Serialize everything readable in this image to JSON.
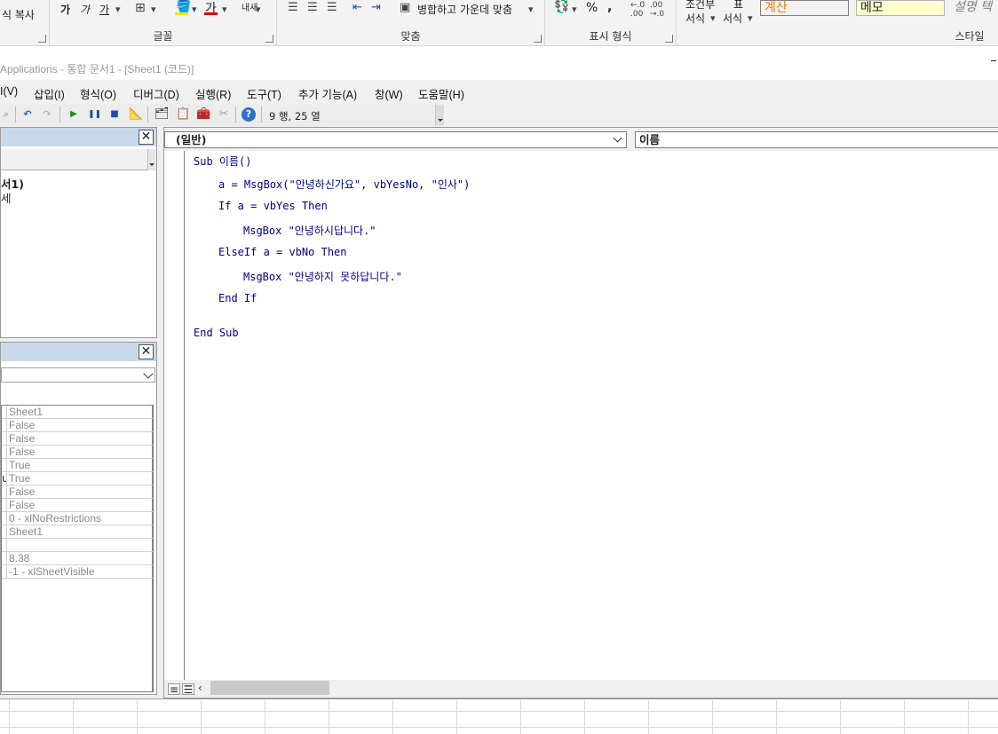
{
  "ribbon": {
    "clipboard_copy_label": "식 복사",
    "font_group_label": "글꼴",
    "align_group_label": "맞춤",
    "merge_label": "병합하고 가운데 맞춤",
    "number_group_label": "표시 형식",
    "conditional_label_1": "조건부",
    "conditional_label_2": "서식",
    "table_label_1": "표",
    "table_label_2": "서식",
    "styles_group_label": "스타일",
    "style_calc": "계산",
    "style_memo": "메모",
    "style_desc": "설명 텍",
    "font_btns": [
      "가",
      "가",
      "가"
    ],
    "wrap_label": "내새",
    "percent": "%",
    "comma": ","
  },
  "vbe": {
    "title": "Applications - 통합 문서1 - [Sheet1 (코드)]",
    "menu": [
      "I(V)",
      "삽입(I)",
      "형식(O)",
      "디버그(D)",
      "실행(R)",
      "도구(T)",
      "추가 기능(A)",
      "창(W)",
      "도움말(H)"
    ],
    "toolbar_status": "9 행, 25 열"
  },
  "project": {
    "tree_items": [
      "서1)",
      "세"
    ]
  },
  "properties": {
    "rows": [
      {
        "key": "",
        "value": "Sheet1"
      },
      {
        "key": "",
        "value": "False"
      },
      {
        "key": "",
        "value": "False"
      },
      {
        "key": "",
        "value": "False"
      },
      {
        "key": "",
        "value": "True"
      },
      {
        "key": "u",
        "value": "True"
      },
      {
        "key": "",
        "value": "False"
      },
      {
        "key": "",
        "value": "False"
      },
      {
        "key": "",
        "value": "0 - xlNoRestrictions"
      },
      {
        "key": "",
        "value": "Sheet1"
      },
      {
        "key": "",
        "value": ""
      },
      {
        "key": "",
        "value": "8.38"
      },
      {
        "key": "",
        "value": "-1 - xlSheetVisible"
      }
    ]
  },
  "code": {
    "object_combo": "(일반)",
    "proc_combo": "이름",
    "lines": [
      "Sub 이름()",
      "a = MsgBox(\"안녕하신가요\", vbYesNo, \"인사\")",
      "If a = vbYes Then",
      "MsgBox \"안녕하시답니다.\"",
      "ElseIf a = vbNo Then",
      "MsgBox \"안녕하지 못하답니다.\"",
      "End If",
      "End Sub"
    ]
  },
  "colors": {
    "code_text": "#00008b",
    "pane_title": "#c9d9ea",
    "style_calc_text": "#fa7d00",
    "style_memo_bg": "#ffffcc",
    "style_calc_bg": "#f2f2f2"
  }
}
